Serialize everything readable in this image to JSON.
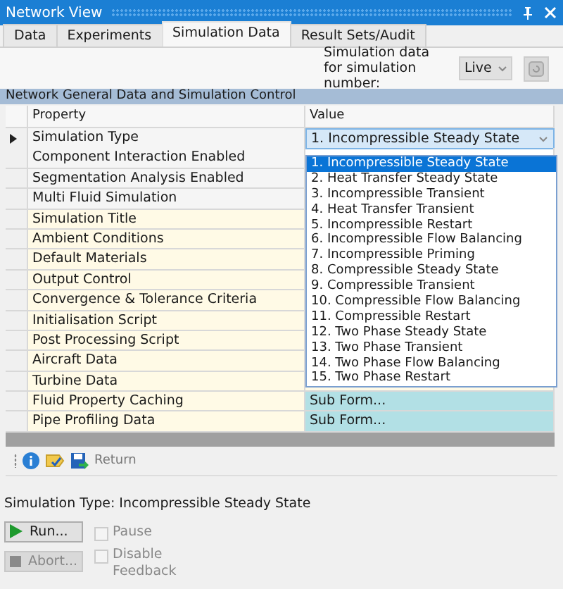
{
  "window": {
    "title": "Network View"
  },
  "tabs": [
    {
      "label": "Data",
      "selected": false
    },
    {
      "label": "Experiments",
      "selected": false
    },
    {
      "label": "Simulation Data",
      "selected": true
    },
    {
      "label": "Result Sets/Audit",
      "selected": false
    }
  ],
  "simulation_number": {
    "label": "Simulation data for simulation number:",
    "value": "Live"
  },
  "section": {
    "title": "Network General Data and Simulation Control"
  },
  "grid": {
    "columns": [
      "Property",
      "Value"
    ],
    "rows": [
      {
        "property": "Simulation Type",
        "value": "1. Incompressible Steady State",
        "kind": "combo",
        "current": true
      },
      {
        "property": "Component Interaction Enabled",
        "kind": "flag",
        "current": false
      },
      {
        "property": "Segmentation Analysis Enabled",
        "kind": "flag",
        "current": false
      },
      {
        "property": "Multi Fluid Simulation",
        "kind": "flag",
        "current": false
      },
      {
        "property": "Simulation Title",
        "kind": "data",
        "current": false
      },
      {
        "property": "Ambient Conditions",
        "kind": "data",
        "current": false
      },
      {
        "property": "Default Materials",
        "kind": "data",
        "current": false
      },
      {
        "property": "Output Control",
        "kind": "data",
        "current": false
      },
      {
        "property": "Convergence & Tolerance Criteria",
        "kind": "data",
        "current": false
      },
      {
        "property": "Initialisation Script",
        "kind": "data",
        "current": false
      },
      {
        "property": "Post Processing Script",
        "kind": "data",
        "current": false
      },
      {
        "property": "Aircraft Data",
        "kind": "data",
        "current": false
      },
      {
        "property": "Turbine Data",
        "kind": "data",
        "current": false
      },
      {
        "property": "Fluid Property Caching",
        "value": "Sub Form...",
        "kind": "form",
        "current": false
      },
      {
        "property": "Pipe Profiling Data",
        "value": "Sub Form...",
        "kind": "form",
        "current": false
      }
    ],
    "dropdown": [
      {
        "label": "1. Incompressible Steady State",
        "selected": true
      },
      {
        "label": "2. Heat Transfer Steady State",
        "selected": false
      },
      {
        "label": "3. Incompressible Transient",
        "selected": false
      },
      {
        "label": "4. Heat Transfer Transient",
        "selected": false
      },
      {
        "label": "5. Incompressible Restart",
        "selected": false
      },
      {
        "label": "6. Incompressible Flow Balancing",
        "selected": false
      },
      {
        "label": "7. Incompressible Priming",
        "selected": false
      },
      {
        "label": "8. Compressible Steady State",
        "selected": false
      },
      {
        "label": "9. Compressible Transient",
        "selected": false
      },
      {
        "label": "10. Compressible Flow Balancing",
        "selected": false
      },
      {
        "label": "11. Compressible Restart",
        "selected": false
      },
      {
        "label": "12. Two Phase Steady State",
        "selected": false
      },
      {
        "label": "13. Two Phase Transient",
        "selected": false
      },
      {
        "label": "14. Two Phase Flow Balancing",
        "selected": false
      },
      {
        "label": "15. Two Phase Restart",
        "selected": false
      }
    ]
  },
  "toolbar": {
    "return_label": "Return",
    "return_disabled": true
  },
  "status": "Simulation Type: Incompressible Steady State",
  "controls": [
    {
      "label": "Run...",
      "kind": "run",
      "disabled": false
    },
    {
      "label": "Abort...",
      "kind": "abort",
      "disabled": true
    }
  ],
  "options": [
    {
      "label": "Pause",
      "checked": false,
      "disabled": true
    },
    {
      "label": "Disable Feedback",
      "checked": false,
      "disabled": true
    }
  ]
}
